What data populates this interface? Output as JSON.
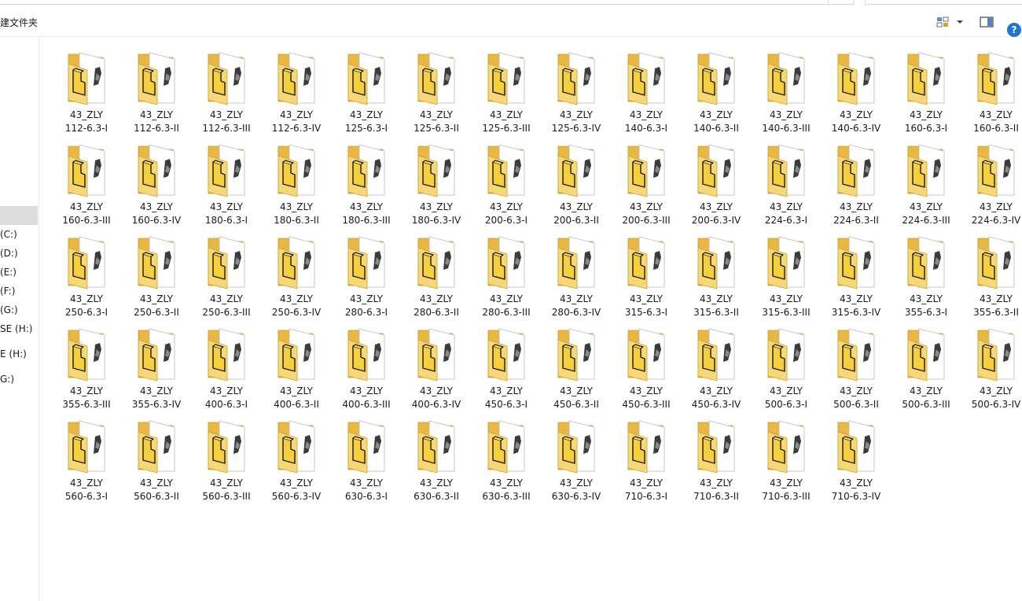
{
  "toolbar": {
    "new_folder_label": "建文件夹",
    "help_label": "?"
  },
  "nav": {
    "items": [
      {
        "label": "(C:)"
      },
      {
        "label": "(D:)"
      },
      {
        "label": "(E:)"
      },
      {
        "label": "(F:)"
      },
      {
        "label": "(G:)"
      },
      {
        "label": "SE (H:)"
      },
      {
        "label": "E (H:)"
      },
      {
        "label": "G:)"
      }
    ]
  },
  "folder_icon": "folder-with-document-icon",
  "colors": {
    "folder_back": "#e8b843",
    "folder_front": "#f8d775",
    "selection": "#dcdcdc",
    "help_blue": "#1e73d6"
  },
  "folders": [
    {
      "line1": "43_ZLY",
      "line2": "112-6.3-I"
    },
    {
      "line1": "43_ZLY",
      "line2": "112-6.3-II"
    },
    {
      "line1": "43_ZLY",
      "line2": "112-6.3-III"
    },
    {
      "line1": "43_ZLY",
      "line2": "112-6.3-IV"
    },
    {
      "line1": "43_ZLY",
      "line2": "125-6.3-I"
    },
    {
      "line1": "43_ZLY",
      "line2": "125-6.3-II"
    },
    {
      "line1": "43_ZLY",
      "line2": "125-6.3-III"
    },
    {
      "line1": "43_ZLY",
      "line2": "125-6.3-IV"
    },
    {
      "line1": "43_ZLY",
      "line2": "140-6.3-I"
    },
    {
      "line1": "43_ZLY",
      "line2": "140-6.3-II"
    },
    {
      "line1": "43_ZLY",
      "line2": "140-6.3-III"
    },
    {
      "line1": "43_ZLY",
      "line2": "140-6.3-IV"
    },
    {
      "line1": "43_ZLY",
      "line2": "160-6.3-I"
    },
    {
      "line1": "43_ZLY",
      "line2": "160-6.3-II"
    },
    {
      "line1": "43_ZLY",
      "line2": "160-6.3-III"
    },
    {
      "line1": "43_ZLY",
      "line2": "160-6.3-IV"
    },
    {
      "line1": "43_ZLY",
      "line2": "180-6.3-I"
    },
    {
      "line1": "43_ZLY",
      "line2": "180-6.3-II"
    },
    {
      "line1": "43_ZLY",
      "line2": "180-6.3-III"
    },
    {
      "line1": "43_ZLY",
      "line2": "180-6.3-IV"
    },
    {
      "line1": "43_ZLY",
      "line2": "200-6.3-I"
    },
    {
      "line1": "43_ZLY",
      "line2": "200-6.3-II"
    },
    {
      "line1": "43_ZLY",
      "line2": "200-6.3-III"
    },
    {
      "line1": "43_ZLY",
      "line2": "200-6.3-IV"
    },
    {
      "line1": "43_ZLY",
      "line2": "224-6.3-I"
    },
    {
      "line1": "43_ZLY",
      "line2": "224-6.3-II"
    },
    {
      "line1": "43_ZLY",
      "line2": "224-6.3-III"
    },
    {
      "line1": "43_ZLY",
      "line2": "224-6.3-IV"
    },
    {
      "line1": "43_ZLY",
      "line2": "250-6.3-I"
    },
    {
      "line1": "43_ZLY",
      "line2": "250-6.3-II"
    },
    {
      "line1": "43_ZLY",
      "line2": "250-6.3-III"
    },
    {
      "line1": "43_ZLY",
      "line2": "250-6.3-IV"
    },
    {
      "line1": "43_ZLY",
      "line2": "280-6.3-I"
    },
    {
      "line1": "43_ZLY",
      "line2": "280-6.3-II"
    },
    {
      "line1": "43_ZLY",
      "line2": "280-6.3-III"
    },
    {
      "line1": "43_ZLY",
      "line2": "280-6.3-IV"
    },
    {
      "line1": "43_ZLY",
      "line2": "315-6.3-I"
    },
    {
      "line1": "43_ZLY",
      "line2": "315-6.3-II"
    },
    {
      "line1": "43_ZLY",
      "line2": "315-6.3-III"
    },
    {
      "line1": "43_ZLY",
      "line2": "315-6.3-IV"
    },
    {
      "line1": "43_ZLY",
      "line2": "355-6.3-I"
    },
    {
      "line1": "43_ZLY",
      "line2": "355-6.3-II"
    },
    {
      "line1": "43_ZLY",
      "line2": "355-6.3-III"
    },
    {
      "line1": "43_ZLY",
      "line2": "355-6.3-IV"
    },
    {
      "line1": "43_ZLY",
      "line2": "400-6.3-I"
    },
    {
      "line1": "43_ZLY",
      "line2": "400-6.3-II"
    },
    {
      "line1": "43_ZLY",
      "line2": "400-6.3-III"
    },
    {
      "line1": "43_ZLY",
      "line2": "400-6.3-IV"
    },
    {
      "line1": "43_ZLY",
      "line2": "450-6.3-I"
    },
    {
      "line1": "43_ZLY",
      "line2": "450-6.3-II"
    },
    {
      "line1": "43_ZLY",
      "line2": "450-6.3-III"
    },
    {
      "line1": "43_ZLY",
      "line2": "450-6.3-IV"
    },
    {
      "line1": "43_ZLY",
      "line2": "500-6.3-I"
    },
    {
      "line1": "43_ZLY",
      "line2": "500-6.3-II"
    },
    {
      "line1": "43_ZLY",
      "line2": "500-6.3-III"
    },
    {
      "line1": "43_ZLY",
      "line2": "500-6.3-IV"
    },
    {
      "line1": "43_ZLY",
      "line2": "560-6.3-I"
    },
    {
      "line1": "43_ZLY",
      "line2": "560-6.3-II"
    },
    {
      "line1": "43_ZLY",
      "line2": "560-6.3-III"
    },
    {
      "line1": "43_ZLY",
      "line2": "560-6.3-IV"
    },
    {
      "line1": "43_ZLY",
      "line2": "630-6.3-I"
    },
    {
      "line1": "43_ZLY",
      "line2": "630-6.3-II"
    },
    {
      "line1": "43_ZLY",
      "line2": "630-6.3-III"
    },
    {
      "line1": "43_ZLY",
      "line2": "630-6.3-IV"
    },
    {
      "line1": "43_ZLY",
      "line2": "710-6.3-I"
    },
    {
      "line1": "43_ZLY",
      "line2": "710-6.3-II"
    },
    {
      "line1": "43_ZLY",
      "line2": "710-6.3-III"
    },
    {
      "line1": "43_ZLY",
      "line2": "710-6.3-IV"
    }
  ]
}
